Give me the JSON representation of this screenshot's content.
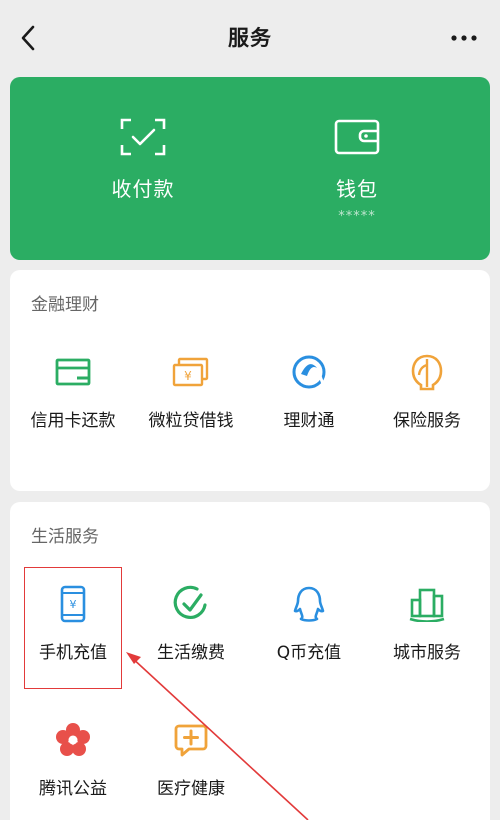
{
  "header": {
    "title": "服务",
    "back_icon": "chevron-left-icon",
    "more_icon": "more-dots-icon"
  },
  "wallet": {
    "background_color": "#2bad63",
    "items": [
      {
        "label": "收付款",
        "icon": "scan-pay-icon"
      },
      {
        "label": "钱包",
        "icon": "wallet-icon",
        "balance_masked": "*****"
      }
    ]
  },
  "finance": {
    "title": "金融理财",
    "items": [
      {
        "label": "信用卡还款",
        "icon": "credit-card-icon",
        "color": "#2bad63"
      },
      {
        "label": "微粒贷借钱",
        "icon": "loan-icon",
        "color": "#f0a33a"
      },
      {
        "label": "理财通",
        "icon": "wealth-icon",
        "color": "#2a8fe0"
      },
      {
        "label": "保险服务",
        "icon": "insurance-icon",
        "color": "#f0a33a"
      }
    ]
  },
  "life": {
    "title": "生活服务",
    "items": [
      {
        "label": "手机充值",
        "icon": "phone-recharge-icon",
        "color": "#2a8fe0"
      },
      {
        "label": "生活缴费",
        "icon": "utility-payment-icon",
        "color": "#2bad63"
      },
      {
        "label": "Q币充值",
        "icon": "qq-coin-icon",
        "color": "#2a8fe0"
      },
      {
        "label": "城市服务",
        "icon": "city-service-icon",
        "color": "#2bad63"
      },
      {
        "label": "腾讯公益",
        "icon": "charity-icon",
        "color": "#e8504a"
      },
      {
        "label": "医疗健康",
        "icon": "medical-icon",
        "color": "#f0a33a"
      }
    ]
  },
  "annotation": {
    "color": "#e23a3a"
  }
}
